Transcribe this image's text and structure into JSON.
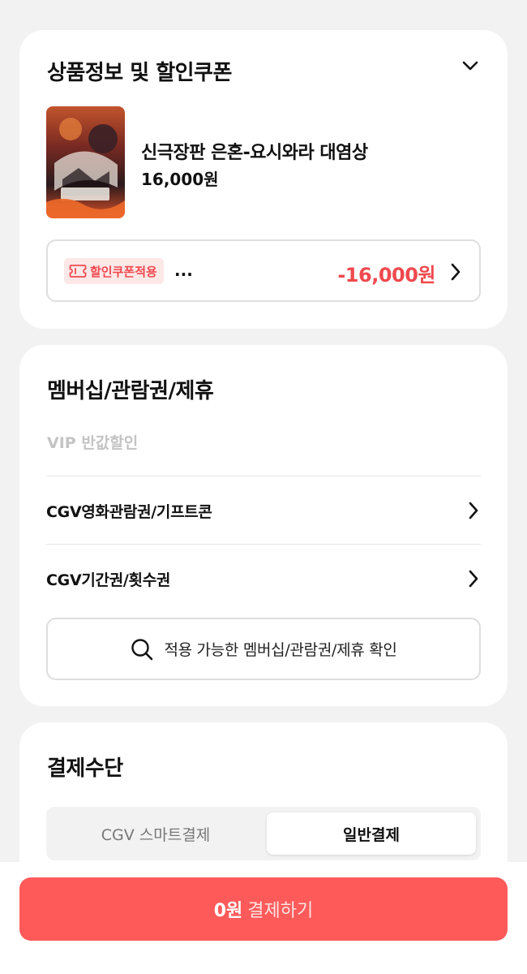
{
  "product_section": {
    "title": "상품정보 및 할인쿠폰",
    "movie_title": "신극장판 은혼-요시와라 대염상",
    "price": "16,000원",
    "coupon": {
      "badge_label": "할인쿠폰적용",
      "ellipsis": "...",
      "discount": "-16,000원"
    }
  },
  "membership_section": {
    "title": "멤버십/관람권/제휴",
    "vip_label": "VIP 반값할인",
    "items": [
      {
        "label": "CGV영화관람권/기프트콘"
      },
      {
        "label": "CGV기간권/횟수권"
      }
    ],
    "check_button_label": "적용 가능한 멤버십/관람권/제휴 확인"
  },
  "payment_section": {
    "title": "결제수단",
    "tabs": [
      {
        "label": "CGV 스마트결제",
        "selected": false
      },
      {
        "label": "일반결제",
        "selected": true
      }
    ]
  },
  "pay_button": {
    "amount": "0원",
    "label": "결제하기"
  },
  "colors": {
    "accent": "#ff5a5a",
    "discount_red": "#f0494e",
    "background": "#f2f2f2"
  }
}
